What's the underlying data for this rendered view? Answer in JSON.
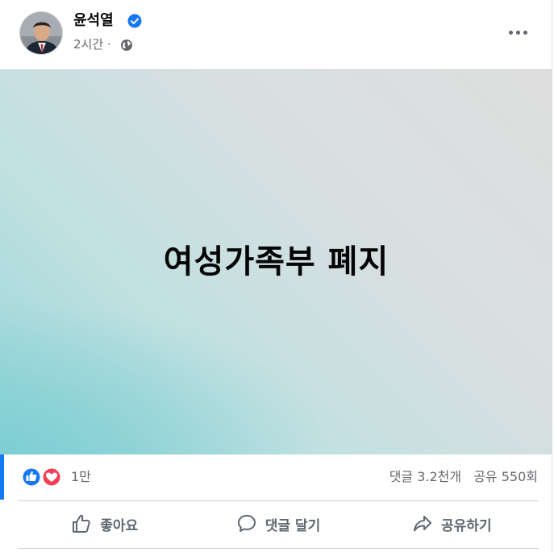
{
  "post": {
    "author": "윤석열",
    "time": "2시간",
    "separator": "·",
    "image_text": "여성가족부 폐지"
  },
  "stats": {
    "reaction_count": "1만",
    "comments": "댓글 3.2천개",
    "shares": "공유 550회"
  },
  "actions": {
    "like": "좋아요",
    "comment": "댓글 달기",
    "share": "공유하기"
  },
  "icons": {
    "verified": "verified-badge-icon",
    "audience": "globe-icon",
    "more": "more-horizontal-icon",
    "like_reaction": "like-reaction-icon",
    "love_reaction": "love-reaction-icon"
  },
  "colors": {
    "brand": "#1877f2",
    "love": "#f33e58",
    "secondary_text": "#65676b"
  }
}
